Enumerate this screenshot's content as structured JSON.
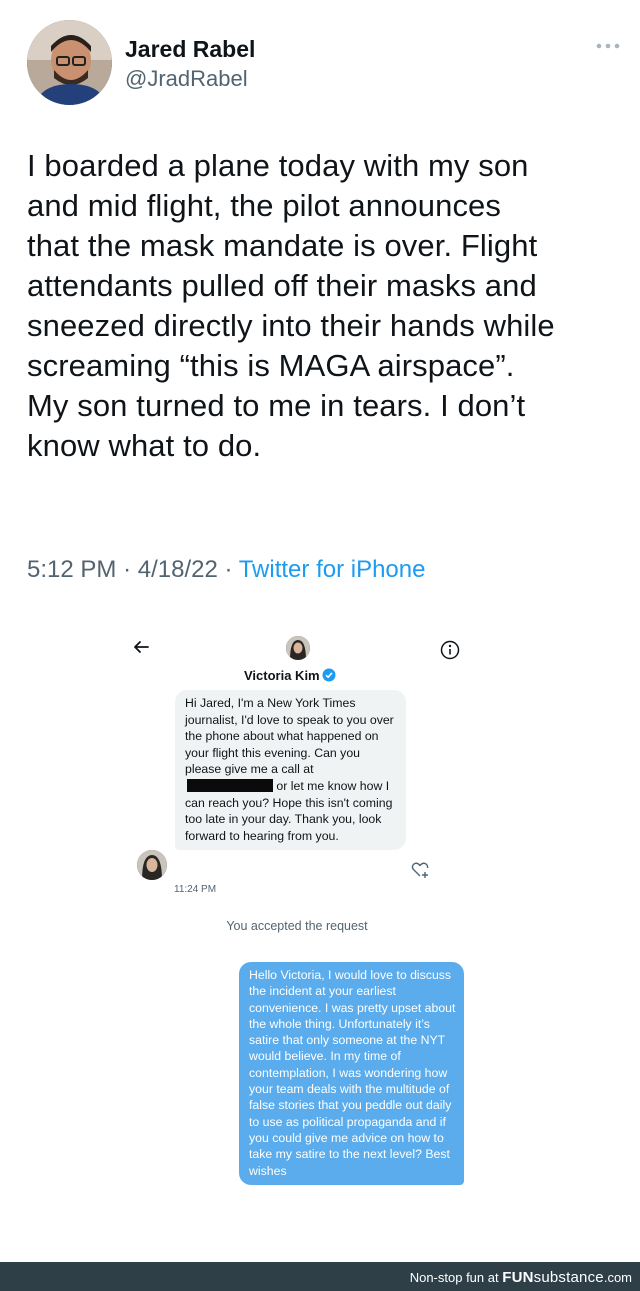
{
  "tweet": {
    "author_name": "Jared Rabel",
    "author_handle": "@JradRabel",
    "text": "I boarded a plane today with my son\nand mid flight, the pilot announces\nthat the mask mandate is over. Flight\nattendants pulled off their masks and\nsneezed directly into their hands while\nscreaming “this is MAGA airspace”.\nMy son turned to me in tears. I don’t\nknow what to do.",
    "time": "5:12 PM",
    "separator": "·",
    "date": "4/18/22",
    "source": "Twitter for iPhone",
    "more_icon": "more-horizontal-icon"
  },
  "dm": {
    "contact_name": "Victoria Kim",
    "verified_icon": "verified-badge-icon",
    "incoming_message_part1": "Hi Jared, I'm a New York Times journalist, I'd love to speak to you over the phone about what happened on your flight this evening. Can you please give me a call at",
    "incoming_message_part2": "or let me know how I can reach you? Hope this isn't coming too late in your day. Thank you, look forward to hearing from you.",
    "incoming_time": "11:24 PM",
    "accepted_notice": "You accepted the request",
    "outgoing_message": "Hello Victoria, I would love to discuss the incident at your earliest convenience. I was pretty upset about the whole thing. Unfortunately it’s satire that only someone at the NYT would believe. In my time of contemplation, I was wondering how your team deals with the multitude of false stories that you peddle out daily to use as political propaganda and if you could give me advice on how to take my satire to the next level? Best wishes",
    "colors": {
      "outgoing_bubble": "#5bacec",
      "incoming_bubble": "#eff3f4",
      "verified": "#1d9bf0"
    }
  },
  "footer": {
    "prefix": "Non-stop fun at ",
    "brand_bold": "FUN",
    "brand_rest": "substance",
    "brand_suffix": ".com"
  }
}
